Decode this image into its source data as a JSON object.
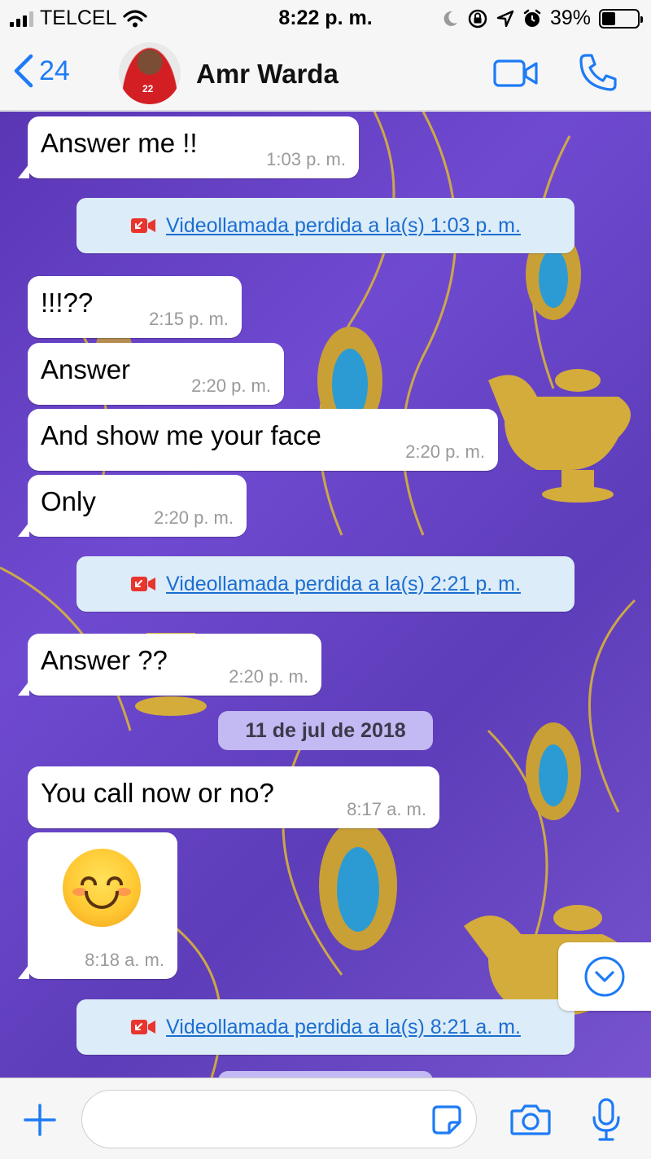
{
  "status_bar": {
    "carrier": "TELCEL",
    "time": "8:22 p. m.",
    "battery_percent": "39%",
    "battery_level": 0.39,
    "icons": [
      "signal-icon",
      "wifi-icon",
      "moon-icon",
      "rotation-lock-icon",
      "location-icon",
      "alarm-icon",
      "battery-icon"
    ]
  },
  "header": {
    "back_count": "24",
    "contact_name": "Amr Warda",
    "avatar_jersey_number": "22",
    "icons": [
      "back-chevron-icon",
      "video-call-icon",
      "phone-call-icon"
    ]
  },
  "colors": {
    "accent": "#1d7bf6",
    "missed_call_red": "#e8352e",
    "system_bubble": "#dcecf8",
    "date_chip": "#c3b9f3"
  },
  "messages": [
    {
      "type": "incoming",
      "text": "Answer me !!",
      "time": "1:03 p. m."
    },
    {
      "type": "system",
      "icon": "missed-video-call-icon",
      "text": "Videollamada perdida a la(s) 1:03 p. m."
    },
    {
      "type": "incoming",
      "text": "!!!??",
      "time": "2:15 p. m."
    },
    {
      "type": "incoming",
      "text": "Answer",
      "time": "2:20 p. m."
    },
    {
      "type": "incoming",
      "text": "And show me your face",
      "time": "2:20 p. m."
    },
    {
      "type": "incoming",
      "text": "Only",
      "time": "2:20 p. m."
    },
    {
      "type": "system",
      "icon": "missed-video-call-icon",
      "text": "Videollamada perdida a la(s) 2:21 p. m."
    },
    {
      "type": "incoming",
      "text": "Answer ??",
      "time": "2:20 p. m."
    },
    {
      "type": "date",
      "text": "11 de jul de 2018"
    },
    {
      "type": "incoming",
      "text": "You call now or no?",
      "time": "8:17 a. m."
    },
    {
      "type": "incoming-emoji",
      "emoji": "smiling-face-icon",
      "time": "8:18 a. m."
    },
    {
      "type": "system",
      "icon": "missed-video-call-icon",
      "text": "Videollamada perdida a la(s) 8:21 a. m."
    }
  ],
  "input_bar": {
    "icons": [
      "plus-icon",
      "sticker-icon",
      "camera-icon",
      "microphone-icon"
    ]
  }
}
